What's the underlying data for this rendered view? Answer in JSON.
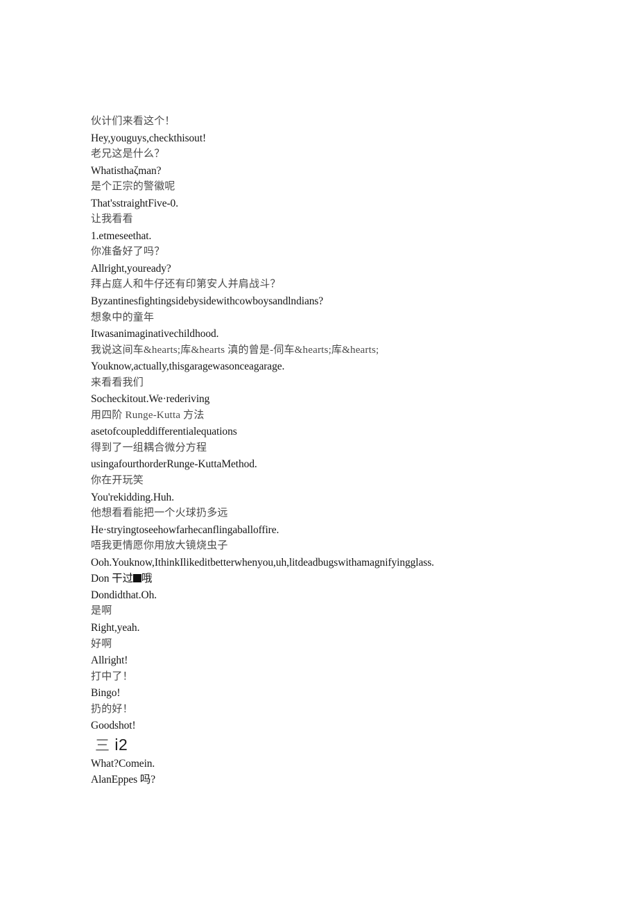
{
  "document": {
    "type": "bilingual-subtitle-transcript",
    "text_color_chinese": "#4a4a4a",
    "text_color_english": "#161616",
    "background_color": "#ffffff",
    "lines": [
      {
        "lang": "zh",
        "text": "伙计们来看这个！"
      },
      {
        "lang": "en",
        "text": "Hey,youguys,checkthisout!"
      },
      {
        "lang": "zh",
        "text": "老兄这是什么？"
      },
      {
        "lang": "en",
        "text": "Whatisthaζman?"
      },
      {
        "lang": "zh",
        "text": "是个正宗的警徽呢"
      },
      {
        "lang": "en",
        "text": "That'sstraightFive-0."
      },
      {
        "lang": "zh",
        "text": "让我看看"
      },
      {
        "lang": "en",
        "text": "1.etmeseethat."
      },
      {
        "lang": "zh",
        "text": "你准备好了吗？"
      },
      {
        "lang": "en",
        "text": "Allright,youready?"
      },
      {
        "lang": "zh",
        "text": "拜占庭人和牛仔还有印第安人并肩战斗？"
      },
      {
        "lang": "en",
        "text": "Byzantinesfightingsidebysidewithcowboysandlndians?"
      },
      {
        "lang": "zh",
        "text": "想象中的童年"
      },
      {
        "lang": "en",
        "text": "Itwasanimaginativechildhood."
      },
      {
        "lang": "zh",
        "text": "我说这间车&hearts;库&hearts 滇的曾是-伺车&hearts;库&hearts;"
      },
      {
        "lang": "en",
        "text": "Youknow,actually,thisgaragewasonceagarage."
      },
      {
        "lang": "zh",
        "text": "来看看我们"
      },
      {
        "lang": "en",
        "text": "Socheckitout.We·rederiving"
      },
      {
        "lang": "zh",
        "text": "用四阶 Runge-Kutta 方法"
      },
      {
        "lang": "en",
        "text": "asetofcoupleddifferentialequations"
      },
      {
        "lang": "zh",
        "text": "得到了一组耦合微分方程"
      },
      {
        "lang": "en",
        "text": "usingafourthorderRunge-KuttaMethod."
      },
      {
        "lang": "zh",
        "text": "你在开玩笑"
      },
      {
        "lang": "en",
        "text": "You'rekidding.Huh."
      },
      {
        "lang": "zh",
        "text": "他想看看能把一个火球扔多远"
      },
      {
        "lang": "en",
        "text": "He·stryingtoseehowfarhecanflingaballoffire."
      },
      {
        "lang": "zh",
        "text": "唔我更情愿你用放大镜烧虫子"
      },
      {
        "lang": "en",
        "text": "Ooh.Youknow,IthinkIlikeditbetterwhenyou,uh,litdeadbugswithamagnifyingglass."
      },
      {
        "lang": "en",
        "text_before_tofu": "Don 干过",
        "tofu": true,
        "text_after_tofu": "哦"
      },
      {
        "lang": "en",
        "text": "Dondidthat.Oh."
      },
      {
        "lang": "zh",
        "text": "是啊"
      },
      {
        "lang": "en",
        "text": "Right,yeah."
      },
      {
        "lang": "zh",
        "text": "好啊"
      },
      {
        "lang": "en",
        "text": "Allright!"
      },
      {
        "lang": "zh",
        "text": "打中了！"
      },
      {
        "lang": "en",
        "text": "Bingo!"
      },
      {
        "lang": "zh",
        "text": "扔的好！"
      },
      {
        "lang": "en",
        "text": "Goodshot!"
      },
      {
        "lang": "heading",
        "glyph": "三",
        "text": " i2"
      },
      {
        "lang": "en",
        "text": "What?Comein."
      },
      {
        "lang": "en",
        "text": "AlanEppes 吗?"
      }
    ]
  }
}
